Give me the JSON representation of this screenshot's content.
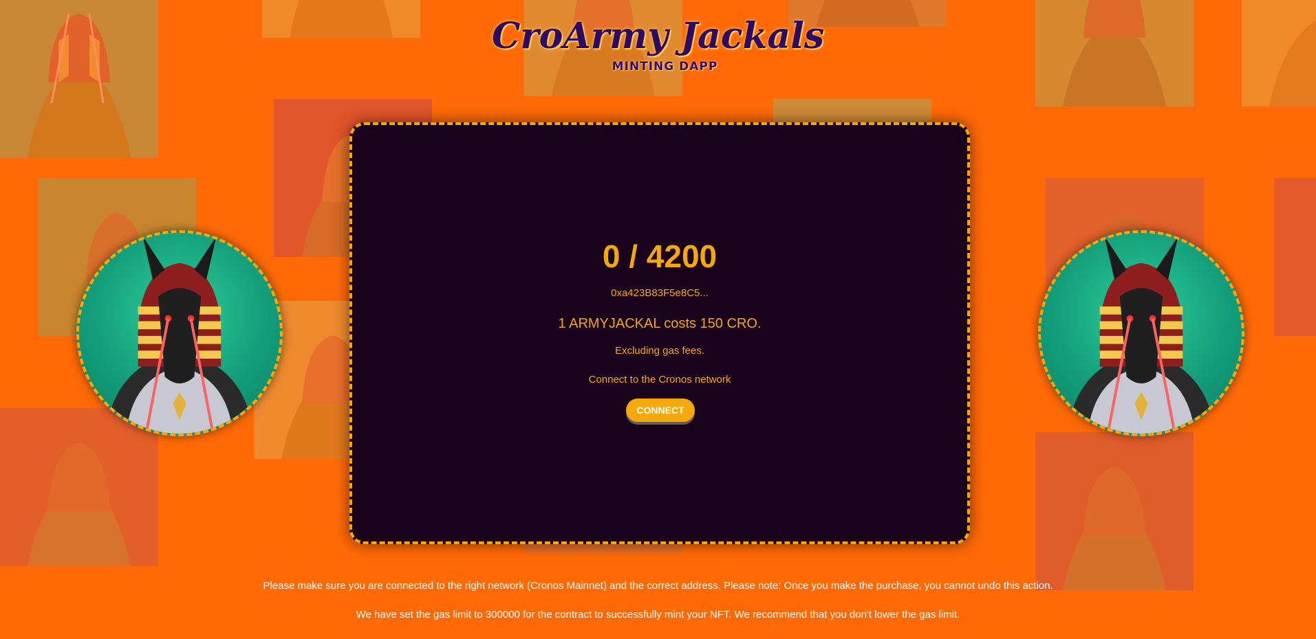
{
  "header": {
    "title": "CroArmy Jackals",
    "subtitle": "MINTING DAPP"
  },
  "mint": {
    "supply_text": "0 / 4200",
    "contract_address": "0xa423B83F5e8C5...",
    "price_text": "1 ARMYJACKAL costs 150 CRO.",
    "gas_note": "Excluding gas fees.",
    "network_prompt": "Connect to the Cronos network",
    "connect_label": "CONNECT"
  },
  "footer": {
    "network_notice": "Please make sure you are connected to the right network (Cronos Mainnet) and the correct address. Please note: Once you make the purchase, you cannot undo this action.",
    "gas_notice": "We have set the gas limit to 300000 for the contract to successfully mint your NFT. We recommend that you don't lower the gas limit."
  },
  "colors": {
    "background": "#ff6a06",
    "panel": "#1a021c",
    "accent": "#f5a80a",
    "title": "#2d0a63",
    "footer_text": "#ffffff"
  },
  "icons": {
    "avatar": "jackal-pharaoh-avatar",
    "background_tile": "jackal-pharaoh-tile"
  }
}
